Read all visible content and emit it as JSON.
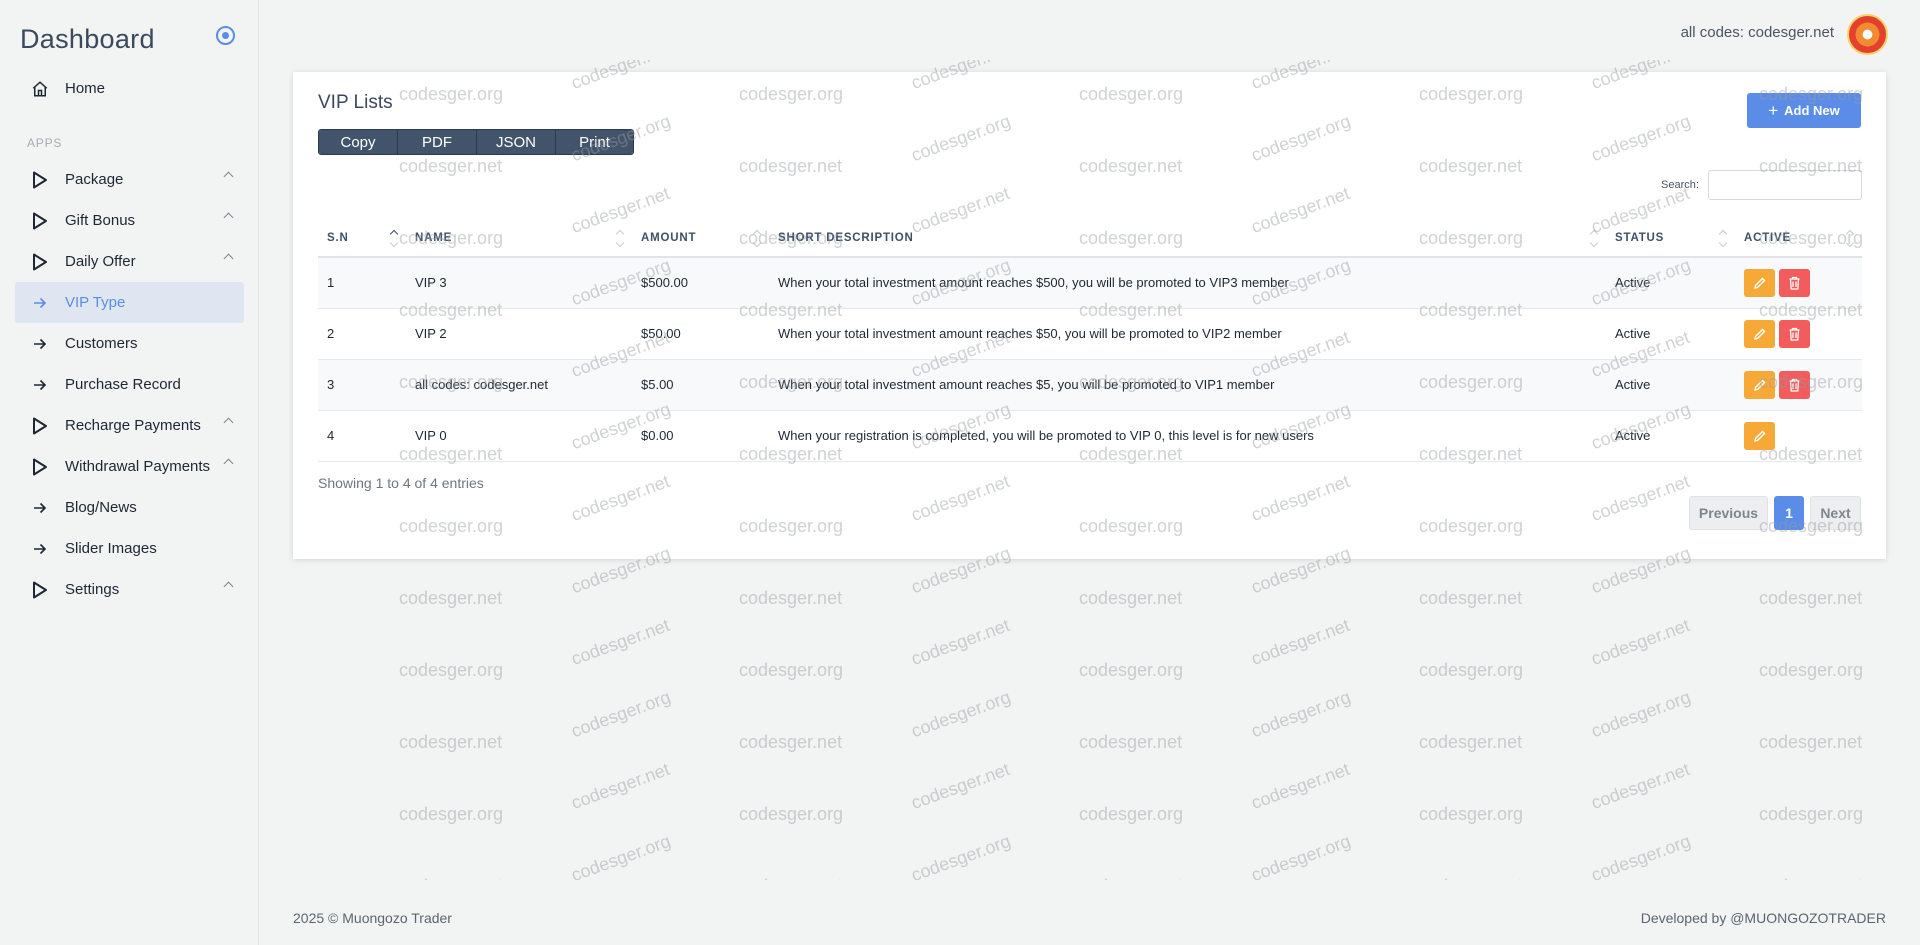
{
  "sidebar": {
    "brand": "Dashboard",
    "home": "Home",
    "section": "APPS",
    "items": [
      {
        "label": "Package",
        "icon": "play-icon",
        "chevron": true
      },
      {
        "label": "Gift Bonus",
        "icon": "play-icon",
        "chevron": true
      },
      {
        "label": "Daily Offer",
        "icon": "play-icon",
        "chevron": true
      },
      {
        "label": "VIP Type",
        "icon": "arrow-right-icon",
        "chevron": false,
        "active": true
      },
      {
        "label": "Customers",
        "icon": "arrow-right-icon",
        "chevron": false
      },
      {
        "label": "Purchase Record",
        "icon": "arrow-right-icon",
        "chevron": false
      },
      {
        "label": "Recharge Payments",
        "icon": "play-icon",
        "chevron": true
      },
      {
        "label": "Withdrawal Payments",
        "icon": "play-icon",
        "chevron": true
      },
      {
        "label": "Blog/News",
        "icon": "arrow-right-icon",
        "chevron": false
      },
      {
        "label": "Slider Images",
        "icon": "arrow-right-icon",
        "chevron": false
      },
      {
        "label": "Settings",
        "icon": "play-icon",
        "chevron": true
      }
    ]
  },
  "header": {
    "site_text": "all codes: codesger.net"
  },
  "card": {
    "title": "VIP Lists",
    "export": [
      "Copy",
      "PDF",
      "JSON",
      "Print"
    ],
    "add_label": "Add New",
    "search_label": "Search:",
    "search_value": "",
    "columns": [
      "S.N",
      "NAME",
      "AMOUNT",
      "SHORT DESCRIPTION",
      "STATUS",
      "ACTIVE"
    ],
    "rows": [
      {
        "sn": "1",
        "name": "VIP 3",
        "amount": "$500.00",
        "desc": "When your total investment amount reaches $500, you will be promoted to VIP3 member",
        "status": "Active"
      },
      {
        "sn": "2",
        "name": "VIP 2",
        "amount": "$50.00",
        "desc": "When your total investment amount reaches $50, you will be promoted to VIP2 member",
        "status": "Active"
      },
      {
        "sn": "3",
        "name": "all codes: codesger.net",
        "amount": "$5.00",
        "desc": "When your total investment amount reaches $5, you will be promoted to VIP1 member",
        "status": "Active"
      },
      {
        "sn": "4",
        "name": "VIP 0",
        "amount": "$0.00",
        "desc": "When your registration is completed, you will be promoted to VIP 0, this level is for new users",
        "status": "Active"
      }
    ],
    "info": "Showing 1 to 4 of 4 entries",
    "pager": {
      "prev": "Previous",
      "current": "1",
      "next": "Next"
    }
  },
  "watermark": [
    "codesger.org",
    "codesger.net"
  ],
  "footer": {
    "left": "2025 © Muongozo Trader",
    "right": "Developed by  @MUONGOZOTRADER"
  },
  "colors": {
    "accent": "#5b8de8",
    "edit": "#f7a937",
    "delete": "#f25c5c",
    "export": "#42546b"
  }
}
